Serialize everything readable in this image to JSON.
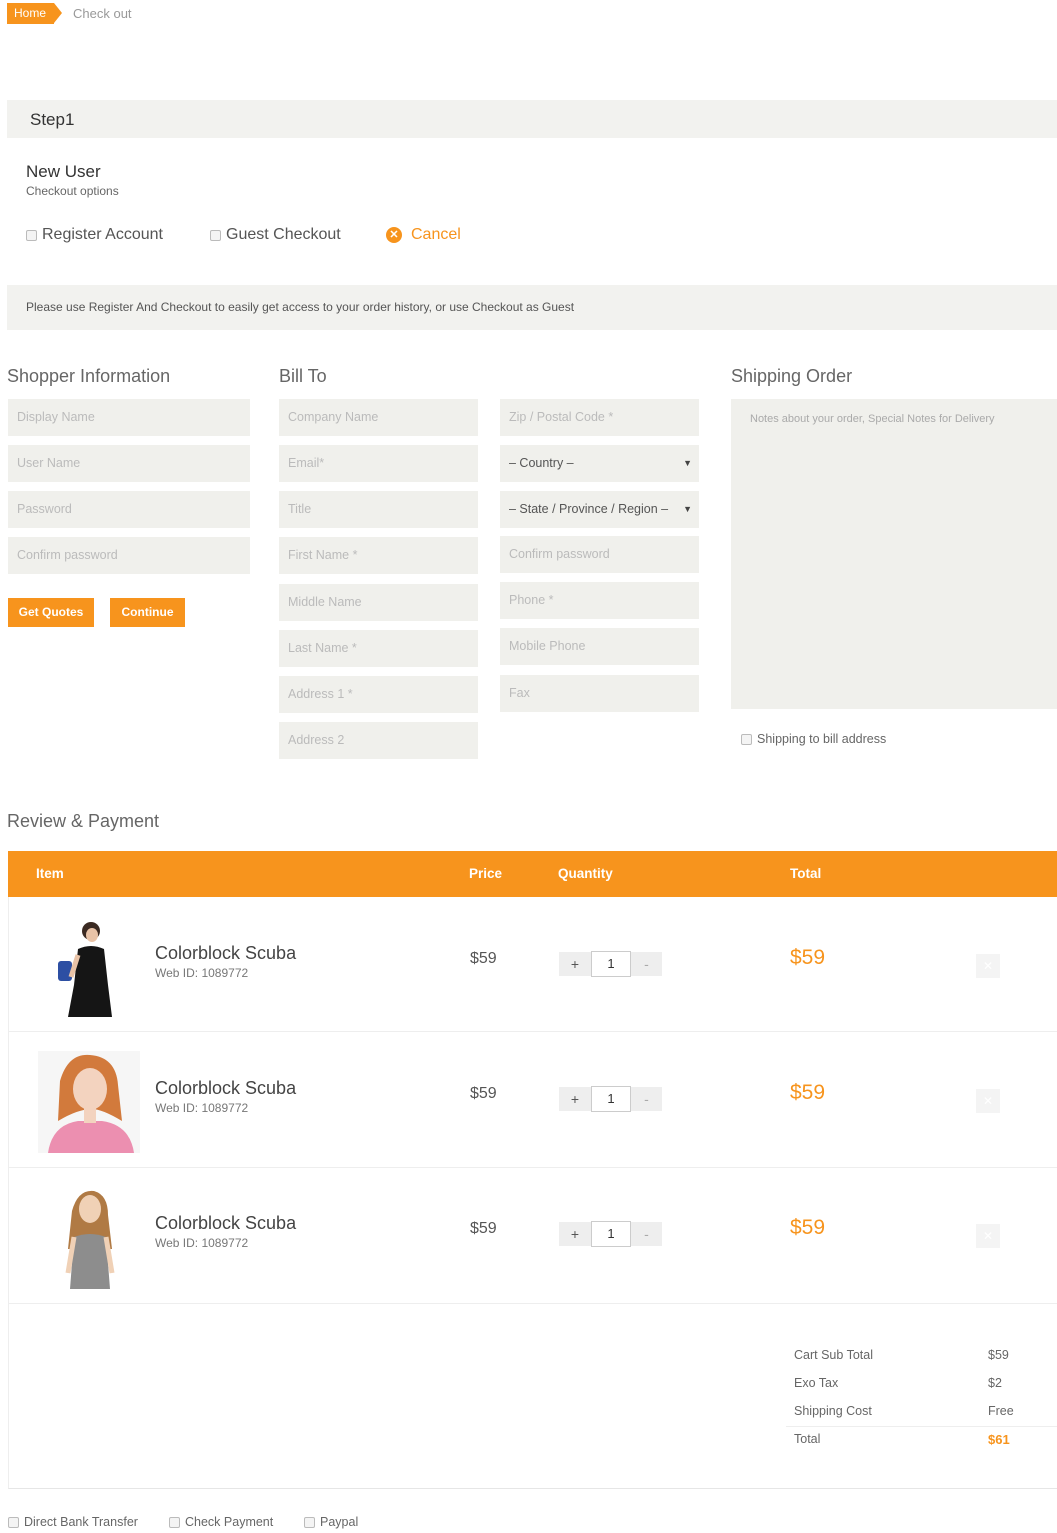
{
  "breadcrumb": {
    "home": "Home",
    "current": "Check out"
  },
  "step": {
    "title": "Step1"
  },
  "new_user": {
    "title": "New User",
    "subtitle": "Checkout options",
    "options": {
      "register": "Register Account",
      "guest": "Guest Checkout",
      "cancel": "Cancel"
    }
  },
  "notice": "Please use Register And Checkout to easily get access to your order history, or use Checkout as Guest",
  "shopper": {
    "heading": "Shopper Information",
    "fields": [
      "Display Name",
      "User Name",
      "Password",
      "Confirm password"
    ],
    "buttons": {
      "quotes": "Get Quotes",
      "continue": "Continue"
    }
  },
  "bill_to": {
    "heading": "Bill To",
    "col1": [
      "Company Name",
      "Email*",
      "Title",
      "First Name *",
      "Middle Name",
      "Last Name *",
      "Address 1 *",
      "Address 2"
    ],
    "zip": "Zip / Postal Code *",
    "country": "– Country –",
    "state": "– State / Province / Region –",
    "col2": [
      "Confirm password",
      "Phone *",
      "Mobile Phone",
      "Fax"
    ]
  },
  "shipping": {
    "heading": "Shipping Order",
    "notes_placeholder": "Notes about your order, Special Notes for Delivery",
    "ship_to_bill": "Shipping to bill address"
  },
  "review": {
    "heading": "Review & Payment",
    "columns": {
      "item": "Item",
      "price": "Price",
      "quantity": "Quantity",
      "total": "Total"
    },
    "items": [
      {
        "name": "Colorblock Scuba",
        "web_id": "Web ID: 1089772",
        "price": "$59",
        "qty": "1",
        "total": "$59"
      },
      {
        "name": "Colorblock Scuba",
        "web_id": "Web ID: 1089772",
        "price": "$59",
        "qty": "1",
        "total": "$59"
      },
      {
        "name": "Colorblock Scuba",
        "web_id": "Web ID: 1089772",
        "price": "$59",
        "qty": "1",
        "total": "$59"
      }
    ],
    "qty_plus": "+",
    "qty_minus": "-",
    "summary": [
      {
        "label": "Cart Sub Total",
        "value": "$59"
      },
      {
        "label": "Exo Tax",
        "value": "$2"
      },
      {
        "label": "Shipping Cost",
        "value": "Free"
      },
      {
        "label": "Total",
        "value": "$61"
      }
    ]
  },
  "payment_methods": [
    "Direct Bank Transfer",
    "Check Payment",
    "Paypal"
  ],
  "colors": {
    "accent": "#f7941d",
    "field_bg": "#f0f0ec",
    "band_bg": "#f2f2ef"
  },
  "icons": {
    "cancel": "cancel-circle-icon",
    "remove": "close-icon",
    "caret": "caret-down-icon"
  }
}
